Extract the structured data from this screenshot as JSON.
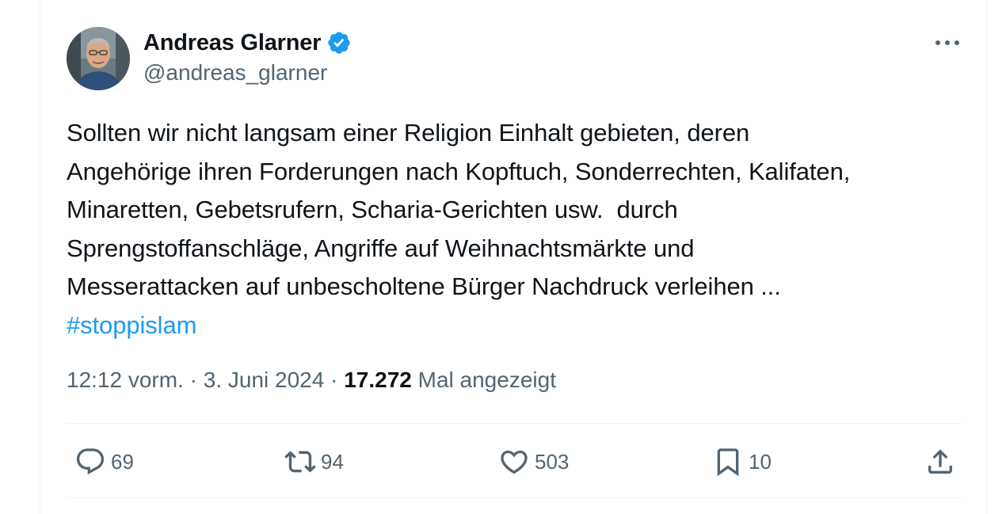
{
  "author": {
    "display_name": "Andreas Glarner",
    "handle": "@andreas_glarner",
    "verified": true,
    "verified_color": "#1d9bf0"
  },
  "tweet": {
    "text_lines": [
      "Sollten wir nicht langsam einer Religion Einhalt gebieten, deren",
      "Angehörige ihren Forderungen nach Kopftuch, Sonderrechten, Kalifaten,",
      "Minaretten, Gebetsrufern, Scharia-Gerichten usw.  durch",
      "Sprengstoffanschläge, Angriffe auf Weihnachtsmärkte und",
      "Messerattacken auf unbescholtene Bürger Nachdruck verleihen ..."
    ],
    "hashtag": "#stoppislam"
  },
  "meta": {
    "time": "12:12 vorm.",
    "separator": " · ",
    "date": "3. Juni 2024",
    "views": "17.272",
    "views_label": " Mal angezeigt"
  },
  "actions": {
    "replies": "69",
    "retweets": "94",
    "likes": "503",
    "bookmarks": "10"
  },
  "icons": {
    "more": "more-horizontal-icon",
    "reply": "reply-icon",
    "retweet": "retweet-icon",
    "like": "heart-icon",
    "bookmark": "bookmark-icon",
    "share": "share-icon"
  },
  "colors": {
    "text": "#0f1419",
    "secondary": "#536471",
    "accent": "#1d9bf0"
  }
}
